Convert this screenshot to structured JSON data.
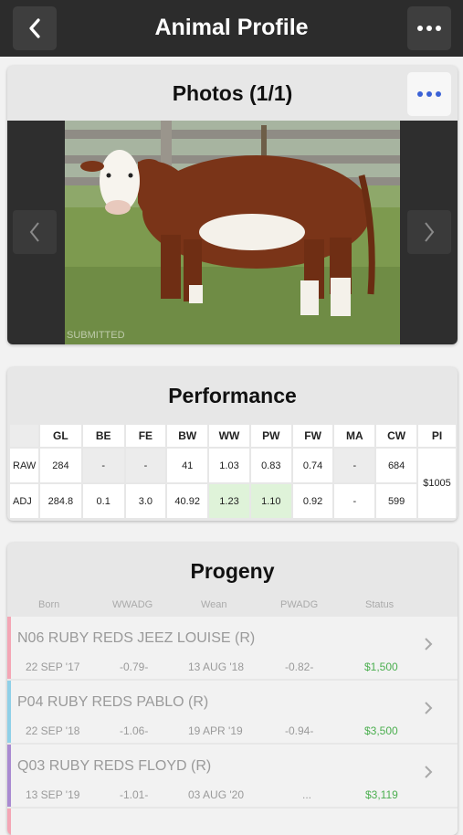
{
  "header": {
    "title": "Animal Profile"
  },
  "photos": {
    "title": "Photos (1/1)",
    "watermark": "SUBMITTED"
  },
  "performance": {
    "title": "Performance",
    "columns": [
      "GL",
      "BE",
      "FE",
      "BW",
      "WW",
      "PW",
      "FW",
      "MA",
      "CW",
      "PI"
    ],
    "rows": [
      {
        "label": "RAW",
        "cells": [
          "284",
          "-",
          "-",
          "41",
          "1.03",
          "0.83",
          "0.74",
          "-",
          "684"
        ]
      },
      {
        "label": "ADJ",
        "cells": [
          "284.8",
          "0.1",
          "3.0",
          "40.92",
          "1.23",
          "1.10",
          "0.92",
          "-",
          "599"
        ]
      }
    ],
    "pi": "$1005"
  },
  "progeny": {
    "title": "Progeny",
    "headers": [
      "Born",
      "WWADG",
      "Wean",
      "PWADG",
      "Status"
    ],
    "items": [
      {
        "name": "N06 RUBY REDS JEEZ LOUISE (R)",
        "born": "22 SEP '17",
        "wwadg": "-0.79-",
        "wean": "13 AUG '18",
        "pwadg": "-0.82-",
        "status": "$1,500",
        "color": "#f4a6b5"
      },
      {
        "name": "P04 RUBY REDS PABLO (R)",
        "born": "22 SEP '18",
        "wwadg": "-1.06-",
        "wean": "19 APR '19",
        "pwadg": "-0.94-",
        "status": "$3,500",
        "color": "#8fd0e8"
      },
      {
        "name": "Q03 RUBY REDS FLOYD (R)",
        "born": "13 SEP '19",
        "wwadg": "-1.01-",
        "wean": "03 AUG '20",
        "pwadg": "...",
        "status": "$3,119",
        "color": "#a98ad1"
      }
    ]
  }
}
